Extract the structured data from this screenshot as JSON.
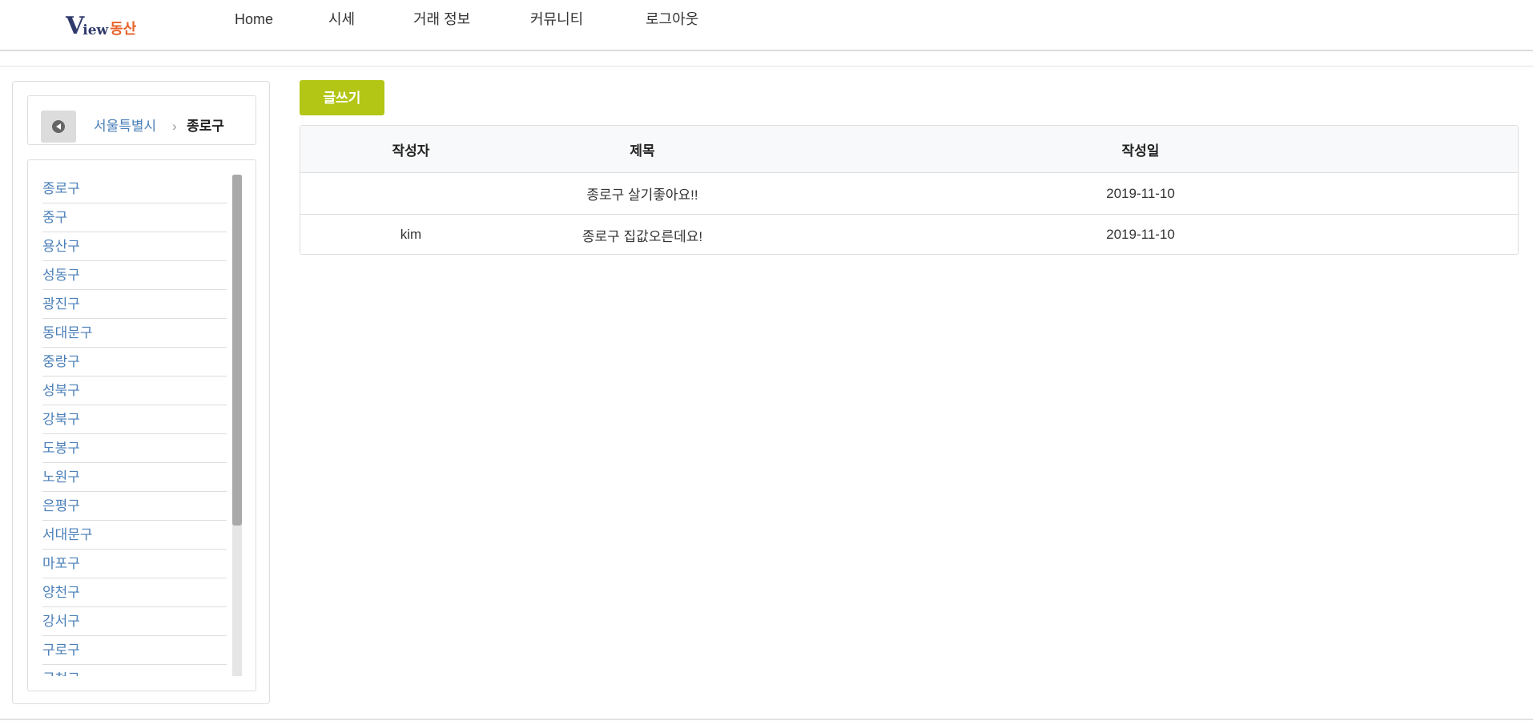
{
  "header": {
    "logo": {
      "latin_big": "V",
      "latin_small": "iew",
      "korean": "동산"
    },
    "nav": [
      "Home",
      "시세",
      "거래 정보",
      "커뮤니티",
      "로그아웃"
    ]
  },
  "sidebar": {
    "breadcrumb": {
      "parent": "서울특별시",
      "separator": "›",
      "current": "종로구"
    },
    "districts": [
      "종로구",
      "중구",
      "용산구",
      "성동구",
      "광진구",
      "동대문구",
      "중랑구",
      "성북구",
      "강북구",
      "도봉구",
      "노원구",
      "은평구",
      "서대문구",
      "마포구",
      "양천구",
      "강서구",
      "구로구",
      "금천구"
    ]
  },
  "board": {
    "write_label": "글쓰기",
    "columns": [
      "작성자",
      "제목",
      "작성일"
    ],
    "rows": [
      {
        "author": "",
        "title": "종로구 살기좋아요!!",
        "date": "2019-11-10"
      },
      {
        "author": "kim",
        "title": "종로구 집값오른데요!",
        "date": "2019-11-10"
      }
    ]
  },
  "colors": {
    "accent": "#b3c616",
    "link": "#4a7fb8",
    "logo_dark": "#2f3a6b",
    "logo_orange": "#e8622a"
  }
}
